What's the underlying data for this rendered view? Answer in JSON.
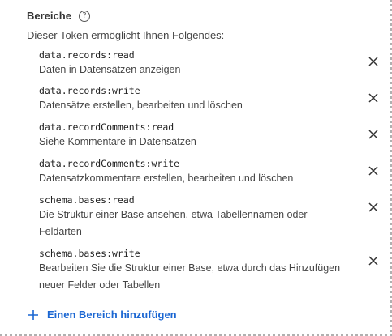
{
  "header": {
    "title": "Bereiche",
    "help_icon": "?"
  },
  "subtitle": "Dieser Token ermöglicht Ihnen Folgendes:",
  "scopes": [
    {
      "code": "data.records:read",
      "description": "Daten in Datensätzen anzeigen"
    },
    {
      "code": "data.records:write",
      "description": "Datensätze erstellen, bearbeiten und löschen"
    },
    {
      "code": "data.recordComments:read",
      "description": "Siehe Kommentare in Datensätzen"
    },
    {
      "code": "data.recordComments:write",
      "description": "Datensatzkommentare erstellen, bearbeiten und löschen"
    },
    {
      "code": "schema.bases:read",
      "description": "Die Struktur einer Base ansehen, etwa Tabellennamen oder Feldarten"
    },
    {
      "code": "schema.bases:write",
      "description": "Bearbeiten Sie die Struktur einer Base, etwa durch das Hinzufügen neuer Felder oder Tabellen"
    }
  ],
  "add_scope": {
    "label": "Einen Bereich hinzufügen"
  },
  "colors": {
    "link": "#1a66d2",
    "text": "#333333"
  },
  "icons": {
    "remove": "close-icon",
    "add": "plus-icon",
    "help": "help-circle-icon"
  }
}
